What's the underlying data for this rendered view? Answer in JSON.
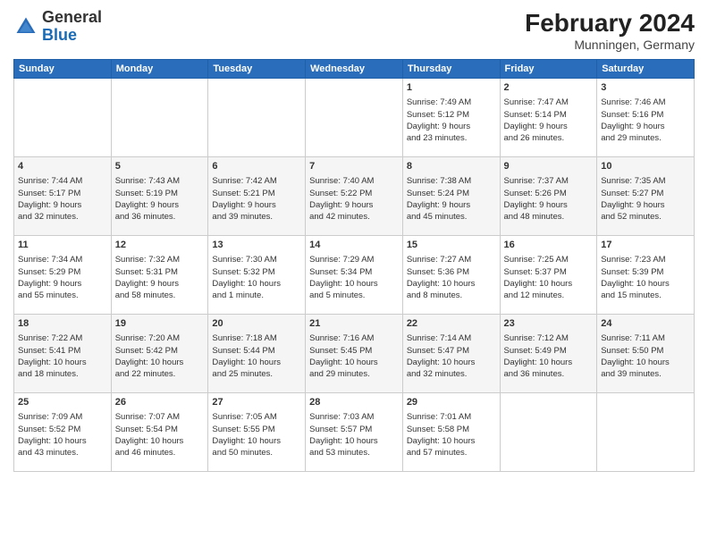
{
  "header": {
    "logo": {
      "general": "General",
      "blue": "Blue"
    },
    "title": "February 2024",
    "location": "Munningen, Germany"
  },
  "calendar": {
    "days_of_week": [
      "Sunday",
      "Monday",
      "Tuesday",
      "Wednesday",
      "Thursday",
      "Friday",
      "Saturday"
    ],
    "weeks": [
      [
        {
          "day": "",
          "info": ""
        },
        {
          "day": "",
          "info": ""
        },
        {
          "day": "",
          "info": ""
        },
        {
          "day": "",
          "info": ""
        },
        {
          "day": "1",
          "info": "Sunrise: 7:49 AM\nSunset: 5:12 PM\nDaylight: 9 hours\nand 23 minutes."
        },
        {
          "day": "2",
          "info": "Sunrise: 7:47 AM\nSunset: 5:14 PM\nDaylight: 9 hours\nand 26 minutes."
        },
        {
          "day": "3",
          "info": "Sunrise: 7:46 AM\nSunset: 5:16 PM\nDaylight: 9 hours\nand 29 minutes."
        }
      ],
      [
        {
          "day": "4",
          "info": "Sunrise: 7:44 AM\nSunset: 5:17 PM\nDaylight: 9 hours\nand 32 minutes."
        },
        {
          "day": "5",
          "info": "Sunrise: 7:43 AM\nSunset: 5:19 PM\nDaylight: 9 hours\nand 36 minutes."
        },
        {
          "day": "6",
          "info": "Sunrise: 7:42 AM\nSunset: 5:21 PM\nDaylight: 9 hours\nand 39 minutes."
        },
        {
          "day": "7",
          "info": "Sunrise: 7:40 AM\nSunset: 5:22 PM\nDaylight: 9 hours\nand 42 minutes."
        },
        {
          "day": "8",
          "info": "Sunrise: 7:38 AM\nSunset: 5:24 PM\nDaylight: 9 hours\nand 45 minutes."
        },
        {
          "day": "9",
          "info": "Sunrise: 7:37 AM\nSunset: 5:26 PM\nDaylight: 9 hours\nand 48 minutes."
        },
        {
          "day": "10",
          "info": "Sunrise: 7:35 AM\nSunset: 5:27 PM\nDaylight: 9 hours\nand 52 minutes."
        }
      ],
      [
        {
          "day": "11",
          "info": "Sunrise: 7:34 AM\nSunset: 5:29 PM\nDaylight: 9 hours\nand 55 minutes."
        },
        {
          "day": "12",
          "info": "Sunrise: 7:32 AM\nSunset: 5:31 PM\nDaylight: 9 hours\nand 58 minutes."
        },
        {
          "day": "13",
          "info": "Sunrise: 7:30 AM\nSunset: 5:32 PM\nDaylight: 10 hours\nand 1 minute."
        },
        {
          "day": "14",
          "info": "Sunrise: 7:29 AM\nSunset: 5:34 PM\nDaylight: 10 hours\nand 5 minutes."
        },
        {
          "day": "15",
          "info": "Sunrise: 7:27 AM\nSunset: 5:36 PM\nDaylight: 10 hours\nand 8 minutes."
        },
        {
          "day": "16",
          "info": "Sunrise: 7:25 AM\nSunset: 5:37 PM\nDaylight: 10 hours\nand 12 minutes."
        },
        {
          "day": "17",
          "info": "Sunrise: 7:23 AM\nSunset: 5:39 PM\nDaylight: 10 hours\nand 15 minutes."
        }
      ],
      [
        {
          "day": "18",
          "info": "Sunrise: 7:22 AM\nSunset: 5:41 PM\nDaylight: 10 hours\nand 18 minutes."
        },
        {
          "day": "19",
          "info": "Sunrise: 7:20 AM\nSunset: 5:42 PM\nDaylight: 10 hours\nand 22 minutes."
        },
        {
          "day": "20",
          "info": "Sunrise: 7:18 AM\nSunset: 5:44 PM\nDaylight: 10 hours\nand 25 minutes."
        },
        {
          "day": "21",
          "info": "Sunrise: 7:16 AM\nSunset: 5:45 PM\nDaylight: 10 hours\nand 29 minutes."
        },
        {
          "day": "22",
          "info": "Sunrise: 7:14 AM\nSunset: 5:47 PM\nDaylight: 10 hours\nand 32 minutes."
        },
        {
          "day": "23",
          "info": "Sunrise: 7:12 AM\nSunset: 5:49 PM\nDaylight: 10 hours\nand 36 minutes."
        },
        {
          "day": "24",
          "info": "Sunrise: 7:11 AM\nSunset: 5:50 PM\nDaylight: 10 hours\nand 39 minutes."
        }
      ],
      [
        {
          "day": "25",
          "info": "Sunrise: 7:09 AM\nSunset: 5:52 PM\nDaylight: 10 hours\nand 43 minutes."
        },
        {
          "day": "26",
          "info": "Sunrise: 7:07 AM\nSunset: 5:54 PM\nDaylight: 10 hours\nand 46 minutes."
        },
        {
          "day": "27",
          "info": "Sunrise: 7:05 AM\nSunset: 5:55 PM\nDaylight: 10 hours\nand 50 minutes."
        },
        {
          "day": "28",
          "info": "Sunrise: 7:03 AM\nSunset: 5:57 PM\nDaylight: 10 hours\nand 53 minutes."
        },
        {
          "day": "29",
          "info": "Sunrise: 7:01 AM\nSunset: 5:58 PM\nDaylight: 10 hours\nand 57 minutes."
        },
        {
          "day": "",
          "info": ""
        },
        {
          "day": "",
          "info": ""
        }
      ]
    ]
  }
}
